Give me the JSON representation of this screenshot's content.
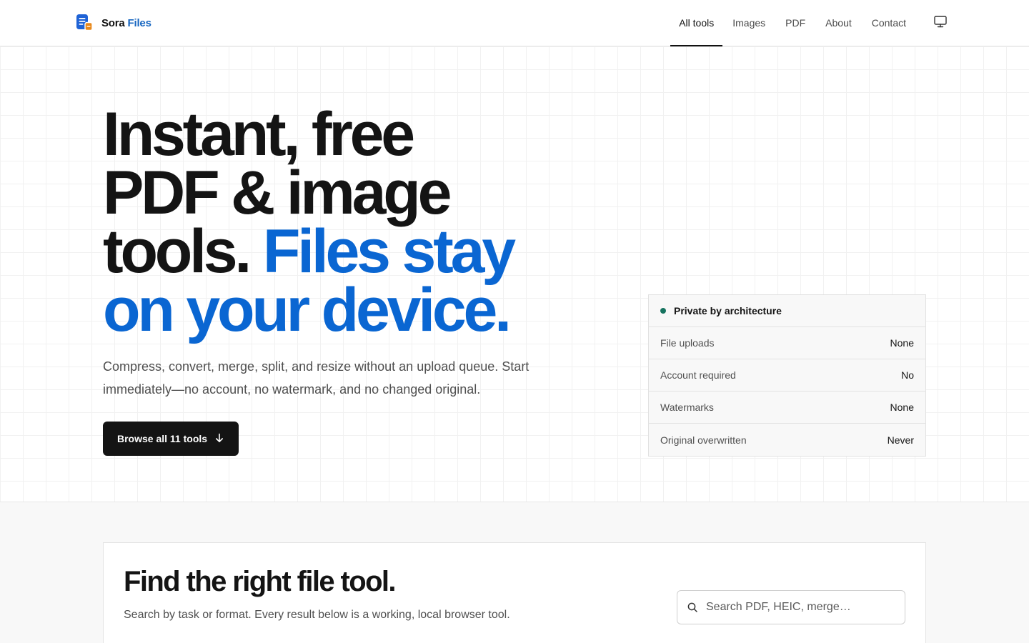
{
  "header": {
    "brand": {
      "name_primary": "Sora",
      "name_accent": "Files",
      "logo_icon": "file-stack-icon"
    },
    "nav": [
      {
        "label": "All tools",
        "active": true
      },
      {
        "label": "Images",
        "active": false
      },
      {
        "label": "PDF",
        "active": false
      },
      {
        "label": "About",
        "active": false
      },
      {
        "label": "Contact",
        "active": false
      }
    ],
    "theme_toggle_icon": "monitor-icon"
  },
  "hero": {
    "headline_lines": [
      "Instant, free",
      "PDF & image",
      "tools."
    ],
    "headline_highlight_line3": "Files stay",
    "headline_highlight_line4": "on your device.",
    "description": "Compress, convert, merge, split, and resize without an upload queue. Start immediately—no account, no watermark, and no changed original.",
    "cta_label": "Browse all 11 tools",
    "cta_icon": "arrow-down-icon"
  },
  "privacy": {
    "title": "Private by architecture",
    "rows": [
      {
        "label": "File uploads",
        "value": "None"
      },
      {
        "label": "Account required",
        "value": "No"
      },
      {
        "label": "Watermarks",
        "value": "None"
      },
      {
        "label": "Original overwritten",
        "value": "Never"
      }
    ]
  },
  "tools": {
    "title": "Find the right file tool.",
    "subtitle": "Search by task or format. Every result below is a working, local browser tool.",
    "search_placeholder": "Search PDF, HEIC, merge…",
    "search_value": ""
  },
  "colors": {
    "accent_blue": "#0a66d2",
    "brand_blue": "#1565c0",
    "logo_orange": "#e8891c",
    "status_green": "#16735f",
    "ink": "#141414"
  }
}
